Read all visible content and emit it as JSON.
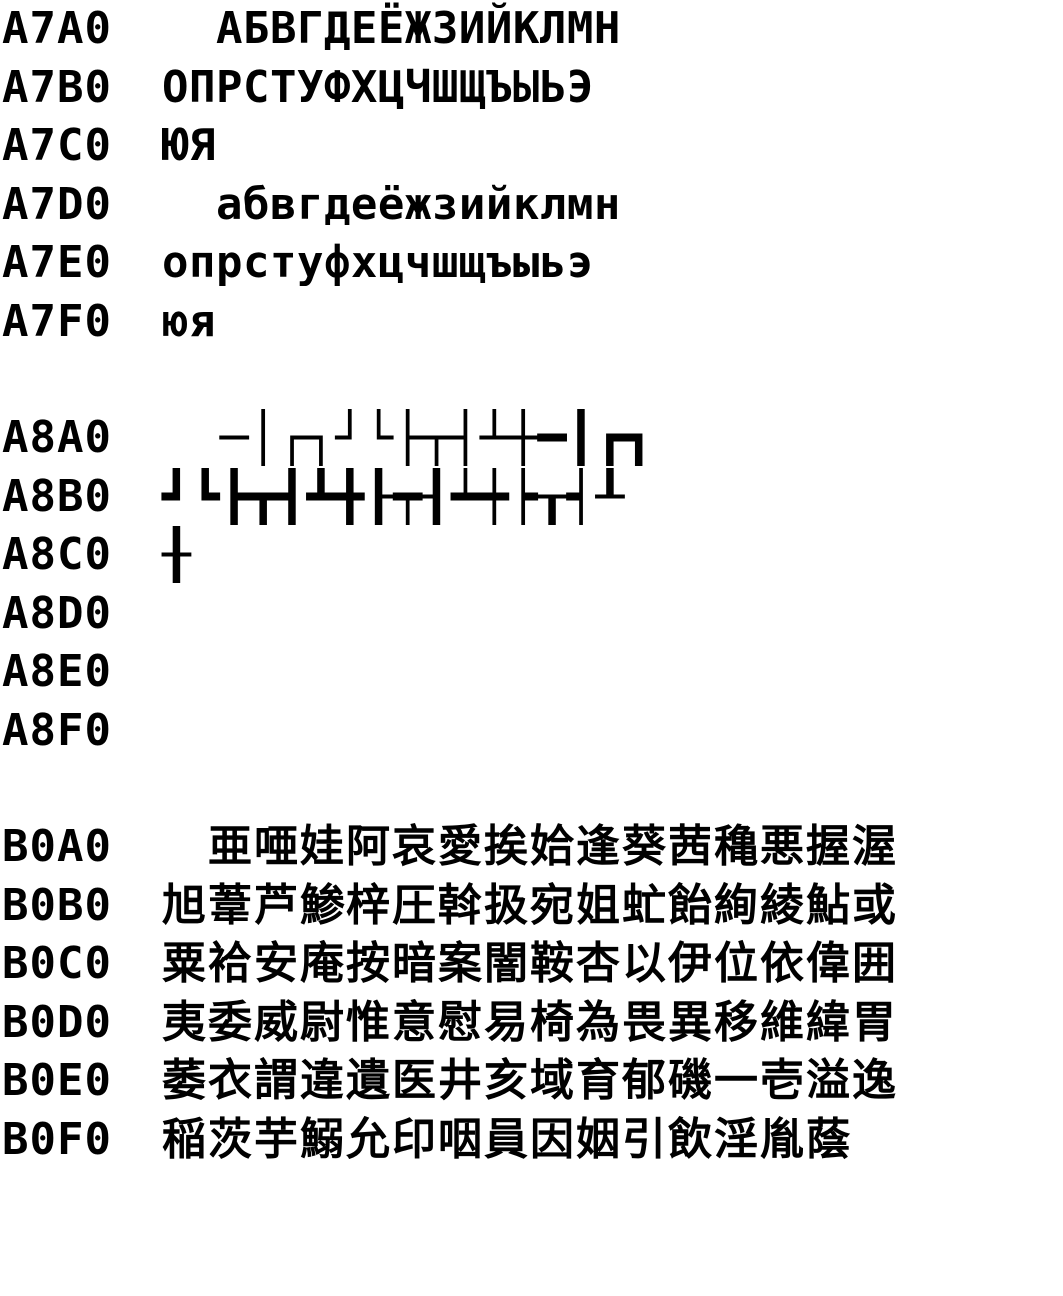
{
  "blocks": [
    {
      "kind": "cyr",
      "rows": [
        {
          "code": "A7A0",
          "chars": "  АБВГДЕЁЖЗИЙКЛМН"
        },
        {
          "code": "A7B0",
          "chars": "ОПРСТУФХЦЧШЩЪЫЬЭ"
        },
        {
          "code": "A7C0",
          "chars": "ЮЯ"
        },
        {
          "code": "A7D0",
          "chars": "  абвгдеёжзийклмн"
        },
        {
          "code": "A7E0",
          "chars": "опрстуфхцчшщъыьэ"
        },
        {
          "code": "A7F0",
          "chars": "юя"
        }
      ]
    },
    {
      "kind": "box",
      "rows": [
        {
          "code": "A8A0",
          "chars": "  ─│┌┐┘└├┬┤┴┼━┃┏┓"
        },
        {
          "code": "A8B0",
          "chars": "┛┗┣┳┫┻╋┠┯┨┷┿┝┰┥┸"
        },
        {
          "code": "A8C0",
          "chars": "╂"
        },
        {
          "code": "A8D0",
          "chars": ""
        },
        {
          "code": "A8E0",
          "chars": ""
        },
        {
          "code": "A8F0",
          "chars": ""
        }
      ]
    },
    {
      "kind": "kanji",
      "rows": [
        {
          "code": "B0A0",
          "chars": "　亜唖娃阿哀愛挨姶逢葵茜穐悪握渥"
        },
        {
          "code": "B0B0",
          "chars": "旭葦芦鯵梓圧斡扱宛姐虻飴絢綾鮎或"
        },
        {
          "code": "B0C0",
          "chars": "粟袷安庵按暗案闇鞍杏以伊位依偉囲"
        },
        {
          "code": "B0D0",
          "chars": "夷委威尉惟意慰易椅為畏異移維緯胃"
        },
        {
          "code": "B0E0",
          "chars": "萎衣謂違遺医井亥域育郁磯一壱溢逸"
        },
        {
          "code": "B0F0",
          "chars": "稲茨芋鰯允印咽員因姻引飲淫胤蔭"
        }
      ]
    }
  ]
}
